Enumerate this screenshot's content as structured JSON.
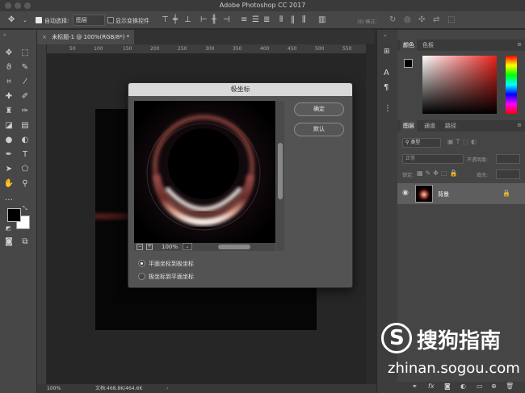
{
  "app": {
    "title": "Adobe Photoshop CC 2017"
  },
  "options": {
    "auto_select_label": "自动选择:",
    "auto_select_value": "图层",
    "show_transform_label": "显示变换控件",
    "mode_3d_label": "3D 模式:"
  },
  "document": {
    "tab_label": "未标题-1 @ 100%(RGB/8*) *",
    "ruler_ticks": [
      "50",
      "100",
      "150",
      "200",
      "250",
      "300",
      "350",
      "400",
      "450",
      "500",
      "550"
    ],
    "zoom": "100%",
    "file_size": "文档:468.8K/464.6K"
  },
  "dialog": {
    "title": "极坐标",
    "ok_label": "确定",
    "default_label": "默认",
    "preview_zoom": "100%",
    "minus_label": "−",
    "plus_label": "+",
    "option_rect_to_polar": "平面坐标到极坐标",
    "option_polar_to_rect": "极坐标到平面坐标",
    "selected_option": "rect_to_polar"
  },
  "panels": {
    "color_tab": "颜色",
    "swatches_tab": "色板",
    "layers_tab": "图层",
    "channels_tab": "通道",
    "paths_tab": "路径",
    "filter_kind": "类型",
    "blend_mode": "正常",
    "opacity_label": "不透明度:",
    "lock_label": "锁定:",
    "fill_label": "填充:",
    "layer_name": "背景"
  },
  "watermark": {
    "brand": "搜狗指南",
    "url": "zhinan.sogou.com"
  },
  "colors": {
    "foreground": "#000000",
    "background": "#ffffff",
    "accent_glow": "#f3b9a6"
  }
}
